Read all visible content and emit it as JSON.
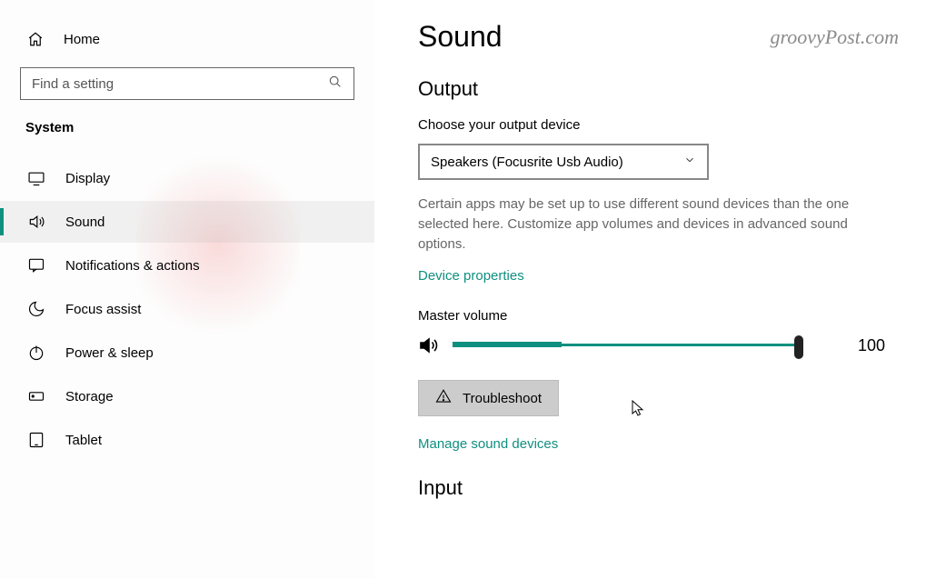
{
  "watermark": "groovyPost.com",
  "sidebar": {
    "home_label": "Home",
    "search_placeholder": "Find a setting",
    "category_label": "System",
    "items": [
      {
        "icon": "display",
        "label": "Display"
      },
      {
        "icon": "sound",
        "label": "Sound"
      },
      {
        "icon": "notifications",
        "label": "Notifications & actions"
      },
      {
        "icon": "focus",
        "label": "Focus assist"
      },
      {
        "icon": "power",
        "label": "Power & sleep"
      },
      {
        "icon": "storage",
        "label": "Storage"
      },
      {
        "icon": "tablet",
        "label": "Tablet"
      }
    ],
    "active_index": 1
  },
  "main": {
    "page_title": "Sound",
    "output": {
      "section_title": "Output",
      "choose_label": "Choose your output device",
      "device_value": "Speakers (Focusrite Usb Audio)",
      "help": "Certain apps may be set up to use different sound devices than the one selected here. Customize app volumes and devices in advanced sound options.",
      "device_props_link": "Device properties",
      "volume_label": "Master volume",
      "volume_value": "100",
      "troubleshoot_label": "Troubleshoot",
      "manage_link": "Manage sound devices"
    },
    "input": {
      "section_title": "Input"
    }
  }
}
